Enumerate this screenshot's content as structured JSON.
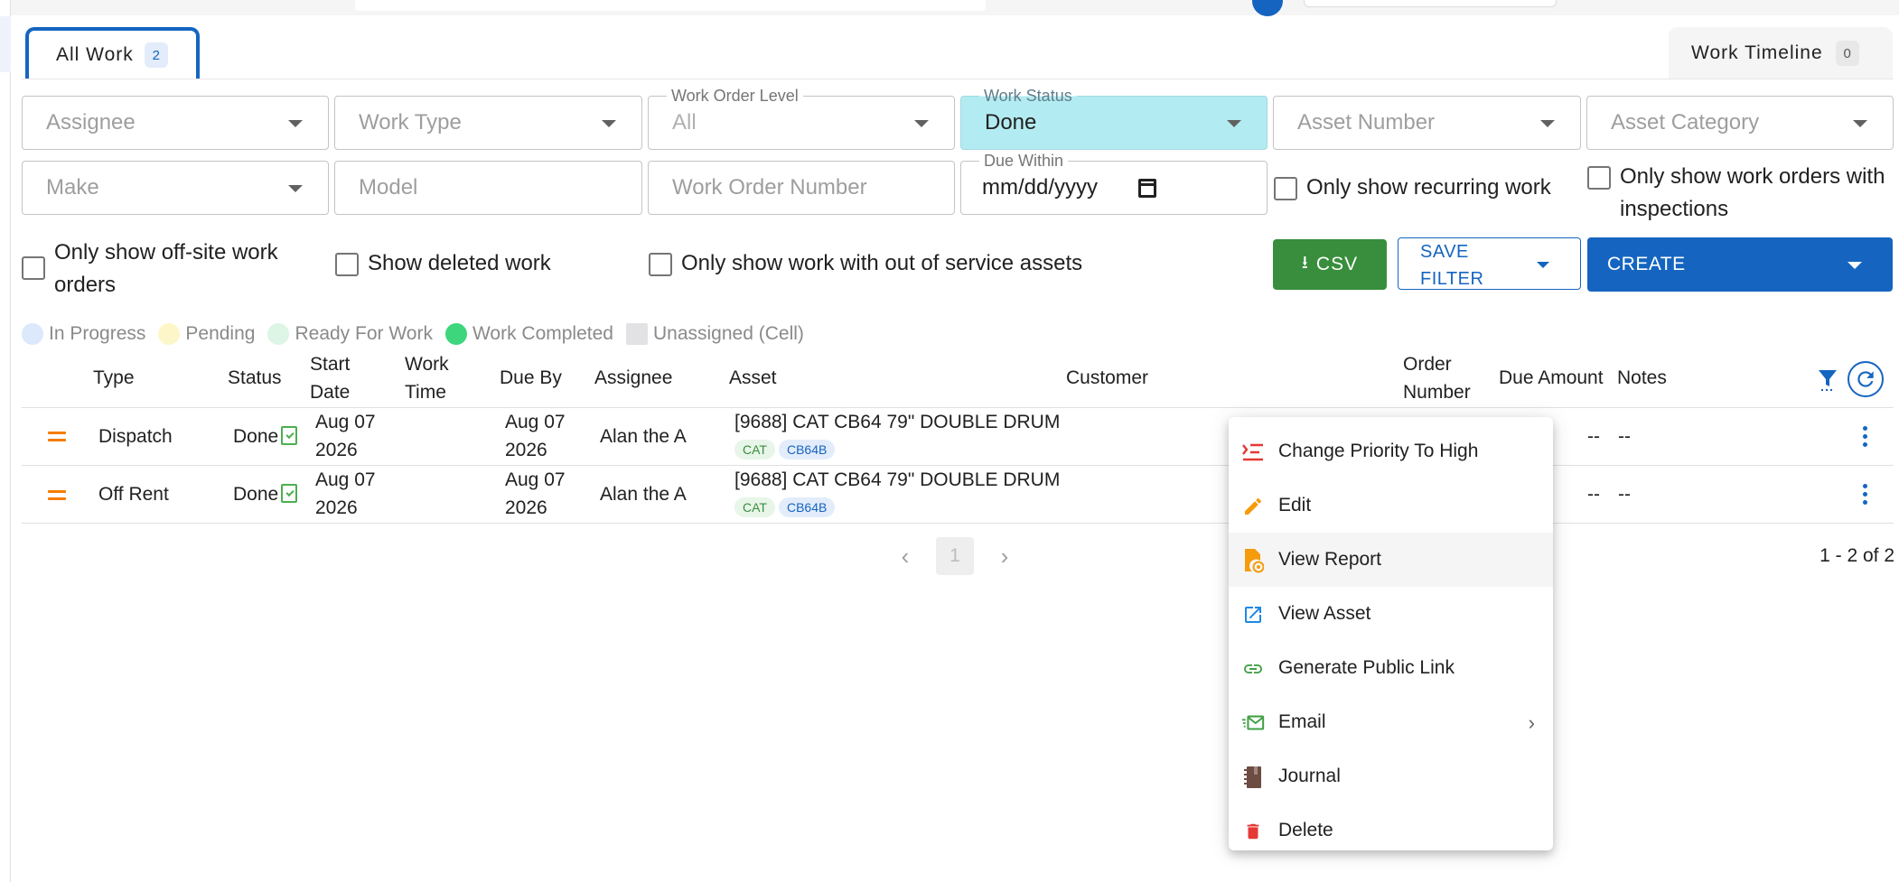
{
  "tabs": {
    "all_work": {
      "label": "All Work",
      "count": "2"
    },
    "timeline": {
      "label": "Work Timeline",
      "count": "0"
    }
  },
  "filters": {
    "assignee": {
      "placeholder": "Assignee"
    },
    "work_type": {
      "placeholder": "Work Type"
    },
    "work_order_level": {
      "label": "Work Order Level",
      "value": "All"
    },
    "work_status": {
      "label": "Work Status",
      "value": "Done"
    },
    "asset_number": {
      "placeholder": "Asset Number"
    },
    "asset_category": {
      "placeholder": "Asset Category"
    },
    "make": {
      "placeholder": "Make"
    },
    "model": {
      "placeholder": "Model"
    },
    "work_order_number": {
      "placeholder": "Work Order Number"
    },
    "due_within": {
      "label": "Due Within",
      "value": "mm/dd/yyyy"
    },
    "checkboxes": {
      "recurring": "Only show recurring work",
      "inspections": "Only show work orders with inspections",
      "offsite": "Only show off-site work orders",
      "deleted": "Show deleted work",
      "out_of_service": "Only show work with out of service assets"
    }
  },
  "actions": {
    "csv": "CSV",
    "save_filter": "SAVE FILTER",
    "create": "CREATE"
  },
  "legend": {
    "in_progress": {
      "label": "In Progress",
      "color": "#dce8fb"
    },
    "pending": {
      "label": "Pending",
      "color": "#fdf6c9"
    },
    "ready": {
      "label": "Ready For Work",
      "color": "#dcf5e5"
    },
    "completed": {
      "label": "Work Completed",
      "color": "#3ed67c"
    },
    "unassigned": {
      "label": "Unassigned (Cell)",
      "color": "#e2e2e4"
    }
  },
  "table": {
    "headers": {
      "type": "Type",
      "status": "Status",
      "start_date": "Start Date",
      "work_time": "Work Time",
      "due_by": "Due By",
      "assignee": "Assignee",
      "asset": "Asset",
      "customer": "Customer",
      "order_number": "Order Number",
      "due_amount": "Due Amount",
      "notes": "Notes"
    },
    "rows": [
      {
        "type": "Dispatch",
        "status": "Done",
        "start_date": "Aug 07 2026",
        "due_by": "Aug 07 2026",
        "assignee": "Alan the A",
        "asset": "[9688] CAT CB64 79\" DOUBLE DRUM",
        "tag_make": "CAT",
        "tag_model": "CB64B",
        "due_amount": "--",
        "notes": "--"
      },
      {
        "type": "Off Rent",
        "status": "Done",
        "start_date": "Aug 07 2026",
        "due_by": "Aug 07 2026",
        "assignee": "Alan the A",
        "asset": "[9688] CAT CB64 79\" DOUBLE DRUM",
        "tag_make": "CAT",
        "tag_model": "CB64B",
        "due_amount": "--",
        "notes": "--"
      }
    ]
  },
  "pagination": {
    "page": "1",
    "range": "1 - 2 of 2"
  },
  "menu": {
    "change_priority": "Change Priority To High",
    "edit": "Edit",
    "view_report": "View Report",
    "view_asset": "View Asset",
    "public_link": "Generate Public Link",
    "email": "Email",
    "journal": "Journal",
    "delete": "Delete"
  }
}
